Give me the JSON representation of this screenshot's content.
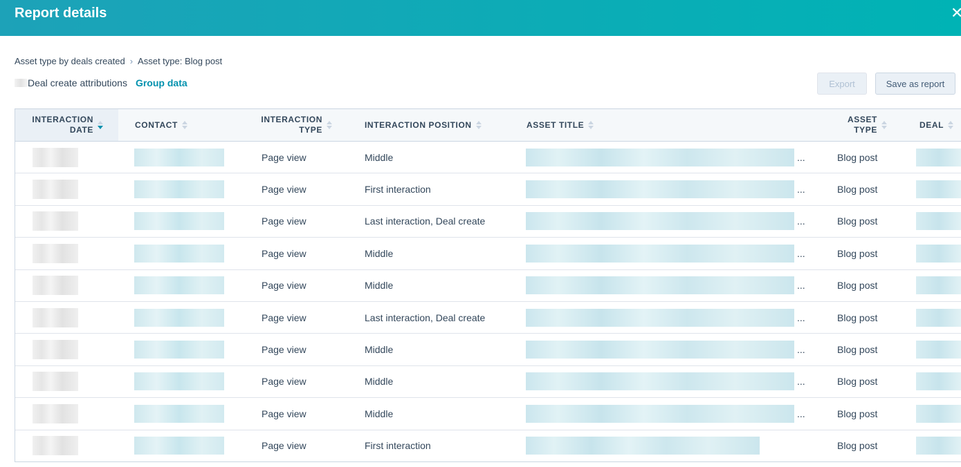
{
  "header": {
    "title": "Report details"
  },
  "breadcrumb": {
    "parent": "Asset type by deals created",
    "separator": "›",
    "current": "Asset type: Blog post"
  },
  "subheader": {
    "label": "Deal create attributions",
    "group_link": "Group data"
  },
  "buttons": {
    "export": "Export",
    "save": "Save as report"
  },
  "table": {
    "columns": [
      {
        "key": "date",
        "line1": "INTERACTION",
        "line2": "DATE"
      },
      {
        "key": "contact",
        "line1": "CONTACT",
        "line2": ""
      },
      {
        "key": "type",
        "line1": "INTERACTION",
        "line2": "TYPE"
      },
      {
        "key": "position",
        "line1": "INTERACTION POSITION",
        "line2": ""
      },
      {
        "key": "title",
        "line1": "ASSET TITLE",
        "line2": ""
      },
      {
        "key": "asset_type",
        "line1": "ASSET",
        "line2": "TYPE"
      },
      {
        "key": "deal",
        "line1": "DEAL",
        "line2": ""
      }
    ],
    "sorted_column": "date",
    "rows": [
      {
        "type": "Page view",
        "position": "Middle",
        "title_truncated": "...",
        "asset_type": "Blog post"
      },
      {
        "type": "Page view",
        "position": "First interaction",
        "title_truncated": "...",
        "asset_type": "Blog post"
      },
      {
        "type": "Page view",
        "position": "Last interaction, Deal create",
        "title_truncated": "...",
        "asset_type": "Blog post"
      },
      {
        "type": "Page view",
        "position": "Middle",
        "title_truncated": "...",
        "asset_type": "Blog post"
      },
      {
        "type": "Page view",
        "position": "Middle",
        "title_truncated": "...",
        "asset_type": "Blog post"
      },
      {
        "type": "Page view",
        "position": "Last interaction, Deal create",
        "title_truncated": "...",
        "asset_type": "Blog post"
      },
      {
        "type": "Page view",
        "position": "Middle",
        "title_truncated": "...",
        "asset_type": "Blog post"
      },
      {
        "type": "Page view",
        "position": "Middle",
        "title_truncated": "...",
        "asset_type": "Blog post"
      },
      {
        "type": "Page view",
        "position": "Middle",
        "title_truncated": "...",
        "asset_type": "Blog post"
      },
      {
        "type": "Page view",
        "position": "First interaction",
        "title_truncated": "",
        "asset_type": "Blog post"
      }
    ]
  },
  "colors": {
    "header_start": "#1da2b8",
    "header_end": "#00b3b5",
    "link": "#0091ae",
    "text": "#33475b"
  }
}
